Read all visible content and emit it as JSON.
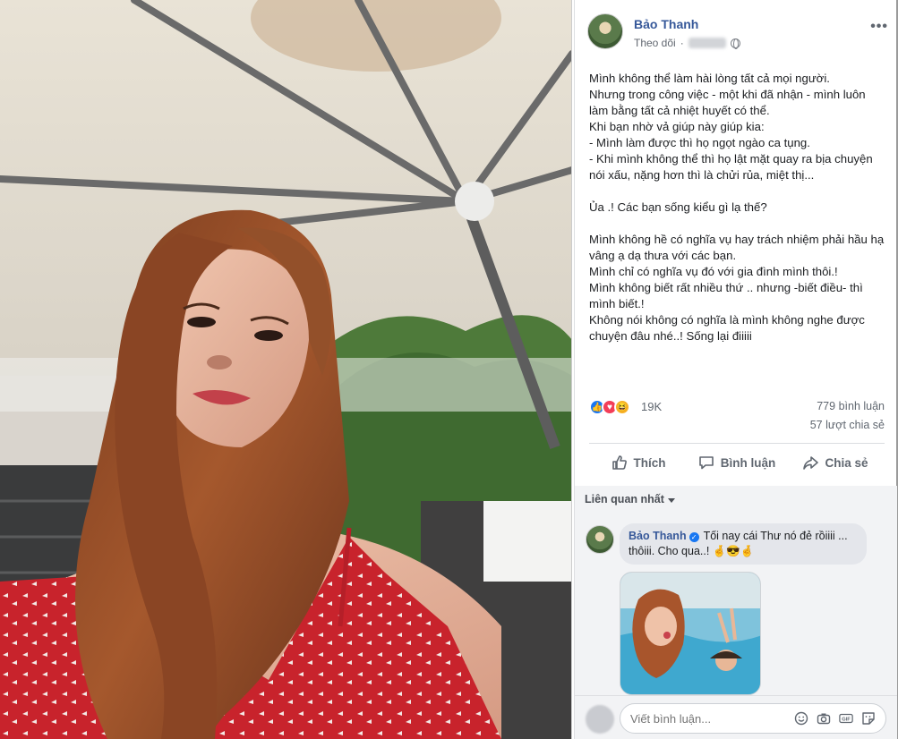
{
  "post": {
    "author": "Bảo Thanh",
    "follow_label": "Theo dõi",
    "separator": "·",
    "text": "Mình không thể làm hài lòng tất cả mọi người.\nNhưng trong công việc - một khi đã nhận - mình luôn làm bằng tất cả nhiệt huyết có thể.\nKhi bạn nhờ vả giúp này giúp kia:\n- Mình làm được thì họ ngọt ngào ca tụng.\n- Khi mình không thể thì họ lật mặt quay ra bịa chuyện nói xấu, nặng hơn thì là chửi rủa, miệt thị...\n\nỦa .! Các bạn sống kiểu gì lạ thế?\n\nMình không hề có nghĩa vụ hay trách nhiệm phải hầu hạ vâng ạ dạ thưa với các bạn.\nMình chỉ có nghĩa vụ đó với gia đình mình thôi.!\nMình không biết rất nhiều thứ .. nhưng -biết điều- thì mình biết.!\nKhông nói không có nghĩa là mình không nghe được chuyện đâu nhé..! Sống lại điiiii"
  },
  "stats": {
    "reactions": "19K",
    "comments": "779 bình luận",
    "shares": "57 lượt chia sẻ"
  },
  "actions": {
    "like": "Thích",
    "comment": "Bình luận",
    "share": "Chia sẻ"
  },
  "comments": {
    "sort_label": "Liên quan nhất",
    "first": {
      "author": "Bảo Thanh",
      "text": "Tối nay cái Thư nó đẻ rồiiii ... thôiii. Cho qua..! 🤞😎🤞"
    },
    "input_placeholder": "Viết bình luận..."
  },
  "icons": {
    "reaction_like": "like-icon",
    "reaction_love": "love-icon",
    "reaction_haha": "haha-icon",
    "input": [
      "emoji-icon",
      "camera-icon",
      "gif-icon",
      "sticker-icon"
    ]
  },
  "colors": {
    "author_link": "#365899",
    "like_blue": "#1877f2",
    "love_red": "#f33e58",
    "haha_yellow": "#f7b125"
  }
}
